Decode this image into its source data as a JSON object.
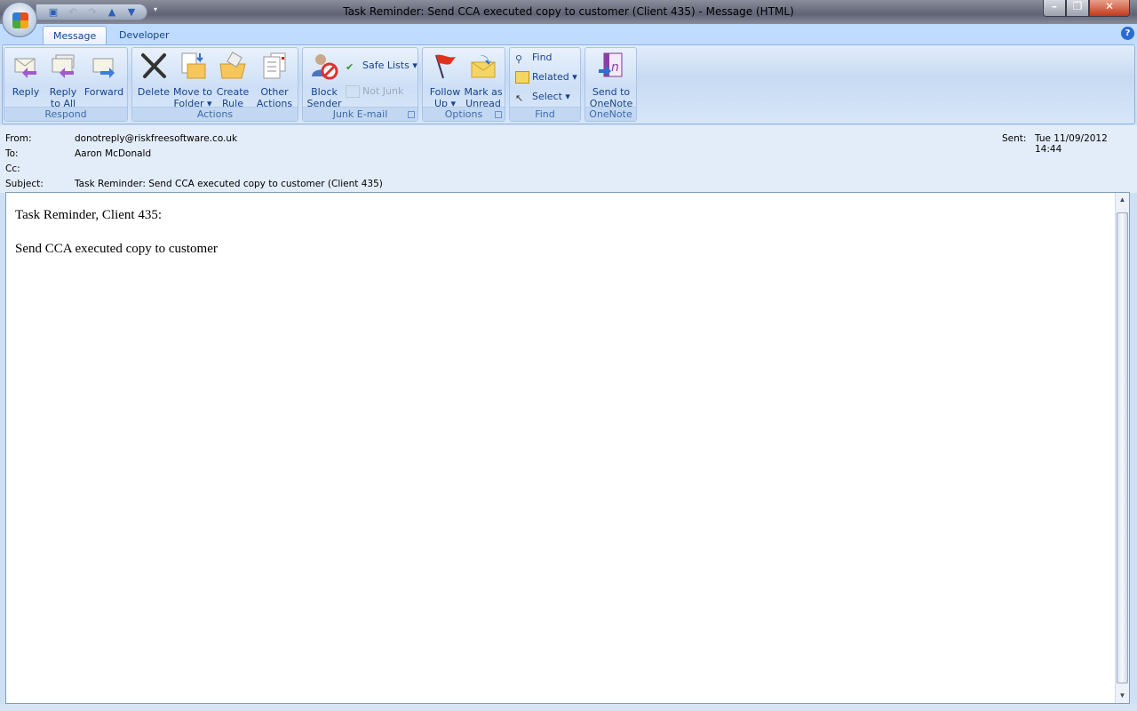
{
  "window": {
    "title": "Task Reminder: Send CCA executed copy to customer (Client 435)  -  Message (HTML)"
  },
  "quick_access": [
    "save-icon",
    "undo-icon",
    "redo-icon",
    "previous-item-icon",
    "next-item-icon",
    "customize-icon"
  ],
  "tabs": [
    {
      "label": "Message",
      "active": true
    },
    {
      "label": "Developer",
      "active": false
    }
  ],
  "ribbon": {
    "respond": {
      "label": "Respond",
      "reply": "Reply",
      "reply_all_1": "Reply",
      "reply_all_2": "to All",
      "forward": "Forward"
    },
    "actions": {
      "label": "Actions",
      "delete": "Delete",
      "move_1": "Move to",
      "move_2": "Folder",
      "rule_1": "Create",
      "rule_2": "Rule",
      "other_1": "Other",
      "other_2": "Actions"
    },
    "junk": {
      "label": "Junk E-mail",
      "block_1": "Block",
      "block_2": "Sender",
      "safe_lists": "Safe Lists",
      "not_junk": "Not Junk"
    },
    "options": {
      "label": "Options",
      "follow_1": "Follow",
      "follow_2": "Up",
      "mark_1": "Mark as",
      "mark_2": "Unread"
    },
    "find": {
      "label": "Find",
      "find": "Find",
      "related": "Related",
      "select": "Select"
    },
    "onenote": {
      "label": "OneNote",
      "send_1": "Send to",
      "send_2": "OneNote"
    }
  },
  "header": {
    "from_label": "From:",
    "from": "donotreply@riskfreesoftware.co.uk",
    "to_label": "To:",
    "to": "Aaron McDonald",
    "cc_label": "Cc:",
    "cc": "",
    "subject_label": "Subject:",
    "subject": "Task Reminder: Send CCA executed copy to customer (Client 435)",
    "sent_label": "Sent:",
    "sent": "Tue 11/09/2012 14:44"
  },
  "body": {
    "line1": "Task Reminder, Client 435:",
    "line2": "Send CCA executed copy to customer"
  }
}
